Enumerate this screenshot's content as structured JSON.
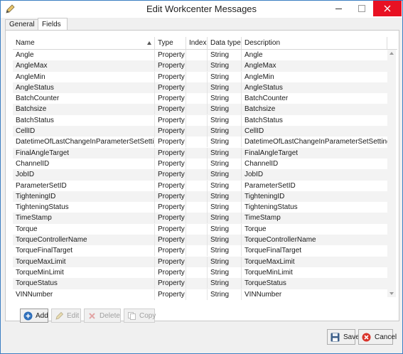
{
  "window": {
    "title": "Edit Workcenter Messages"
  },
  "tabs": [
    {
      "label": "General"
    },
    {
      "label": "Fields"
    }
  ],
  "grid": {
    "columns": [
      {
        "label": "Name"
      },
      {
        "label": "Type"
      },
      {
        "label": "Index"
      },
      {
        "label": "Data type"
      },
      {
        "label": "Description"
      }
    ],
    "rows": [
      {
        "name": "Angle",
        "type": "Property",
        "index": "",
        "dtype": "String",
        "desc": "Angle"
      },
      {
        "name": "AngleMax",
        "type": "Property",
        "index": "",
        "dtype": "String",
        "desc": "AngleMax"
      },
      {
        "name": "AngleMin",
        "type": "Property",
        "index": "",
        "dtype": "String",
        "desc": "AngleMin"
      },
      {
        "name": "AngleStatus",
        "type": "Property",
        "index": "",
        "dtype": "String",
        "desc": "AngleStatus"
      },
      {
        "name": "BatchCounter",
        "type": "Property",
        "index": "",
        "dtype": "String",
        "desc": "BatchCounter"
      },
      {
        "name": "Batchsize",
        "type": "Property",
        "index": "",
        "dtype": "String",
        "desc": "Batchsize"
      },
      {
        "name": "BatchStatus",
        "type": "Property",
        "index": "",
        "dtype": "String",
        "desc": "BatchStatus"
      },
      {
        "name": "CellID",
        "type": "Property",
        "index": "",
        "dtype": "String",
        "desc": "CellID"
      },
      {
        "name": "DatetimeOfLastChangeInParameterSetSettings",
        "type": "Property",
        "index": "",
        "dtype": "String",
        "desc": "DatetimeOfLastChangeInParameterSetSettings"
      },
      {
        "name": "FinalAngleTarget",
        "type": "Property",
        "index": "",
        "dtype": "String",
        "desc": "FinalAngleTarget"
      },
      {
        "name": "ChannelID",
        "type": "Property",
        "index": "",
        "dtype": "String",
        "desc": "ChannelID"
      },
      {
        "name": "JobID",
        "type": "Property",
        "index": "",
        "dtype": "String",
        "desc": "JobID"
      },
      {
        "name": "ParameterSetID",
        "type": "Property",
        "index": "",
        "dtype": "String",
        "desc": "ParameterSetID"
      },
      {
        "name": "TighteningID",
        "type": "Property",
        "index": "",
        "dtype": "String",
        "desc": "TighteningID"
      },
      {
        "name": "TighteningStatus",
        "type": "Property",
        "index": "",
        "dtype": "String",
        "desc": "TighteningStatus"
      },
      {
        "name": "TimeStamp",
        "type": "Property",
        "index": "",
        "dtype": "String",
        "desc": "TimeStamp"
      },
      {
        "name": "Torque",
        "type": "Property",
        "index": "",
        "dtype": "String",
        "desc": "Torque"
      },
      {
        "name": "TorqueControllerName",
        "type": "Property",
        "index": "",
        "dtype": "String",
        "desc": "TorqueControllerName"
      },
      {
        "name": "TorqueFinalTarget",
        "type": "Property",
        "index": "",
        "dtype": "String",
        "desc": "TorqueFinalTarget"
      },
      {
        "name": "TorqueMaxLimit",
        "type": "Property",
        "index": "",
        "dtype": "String",
        "desc": "TorqueMaxLimit"
      },
      {
        "name": "TorqueMinLimit",
        "type": "Property",
        "index": "",
        "dtype": "String",
        "desc": "TorqueMinLimit"
      },
      {
        "name": "TorqueStatus",
        "type": "Property",
        "index": "",
        "dtype": "String",
        "desc": "TorqueStatus"
      },
      {
        "name": "VINNumber",
        "type": "Property",
        "index": "",
        "dtype": "String",
        "desc": "VINNumber"
      }
    ]
  },
  "toolbar": {
    "add_label": "Add",
    "edit_label": "Edit",
    "delete_label": "Delete",
    "copy_label": "Copy"
  },
  "footer": {
    "save_label": "Save",
    "cancel_label": "Cancel"
  },
  "colors": {
    "accent": "#3c7fc2",
    "close": "#e81123",
    "add_icon": "#2f6fba",
    "cancel_icon": "#d9342b"
  }
}
